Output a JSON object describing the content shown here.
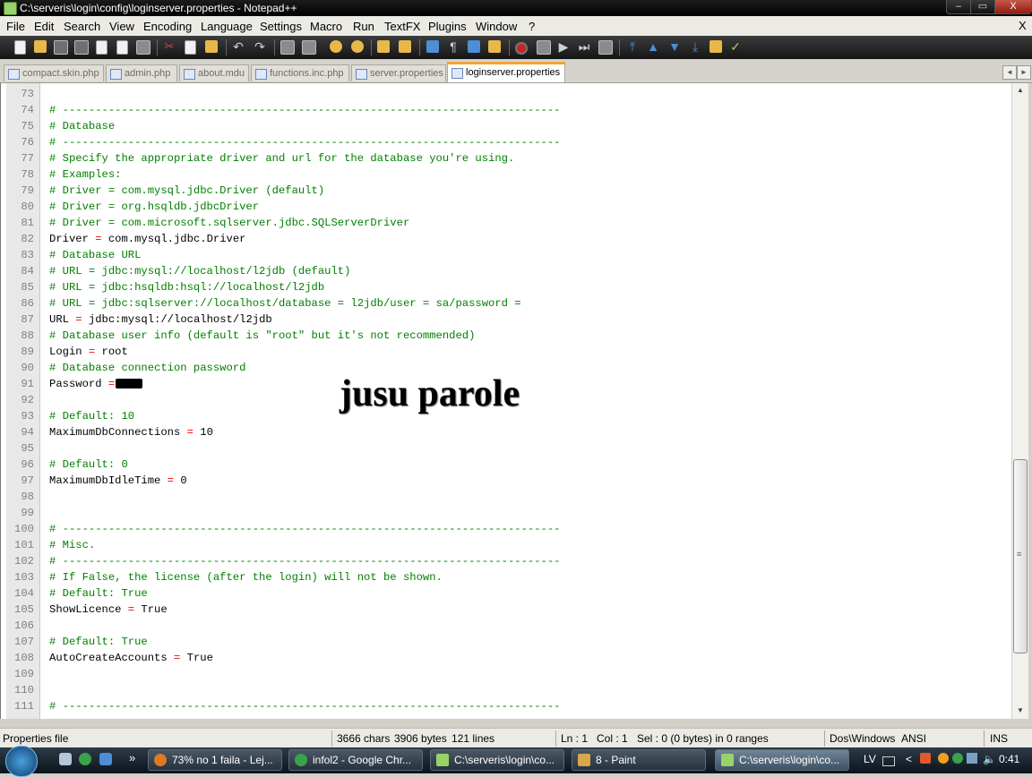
{
  "window": {
    "title": "C:\\serveris\\login\\config\\loginserver.properties - Notepad++",
    "min_glyph": "–",
    "max_glyph": "▭",
    "close_glyph": "X"
  },
  "menu": {
    "items": [
      "File",
      "Edit",
      "Search",
      "View",
      "Encoding",
      "Language",
      "Settings",
      "Macro",
      "Run",
      "TextFX",
      "Plugins",
      "Window",
      "?"
    ],
    "close_label": "X"
  },
  "tabs": [
    {
      "label": "compact.skin.php",
      "active": false
    },
    {
      "label": "admin.php",
      "active": false
    },
    {
      "label": "about.mdu",
      "active": false
    },
    {
      "label": "functions.inc.php",
      "active": false
    },
    {
      "label": "server.properties",
      "active": false
    },
    {
      "label": "loginserver.properties",
      "active": true
    }
  ],
  "tab_scroll": {
    "left": "◄",
    "right": "►"
  },
  "editor": {
    "lines": [
      {
        "n": "73",
        "type": "blank"
      },
      {
        "n": "74",
        "type": "comment",
        "text": "# ----------------------------------------------------------------------------"
      },
      {
        "n": "75",
        "type": "comment",
        "text": "# Database"
      },
      {
        "n": "76",
        "type": "comment",
        "text": "# ----------------------------------------------------------------------------"
      },
      {
        "n": "77",
        "type": "comment",
        "text": "# Specify the appropriate driver and url for the database you're using."
      },
      {
        "n": "78",
        "type": "comment",
        "text": "# Examples:"
      },
      {
        "n": "79",
        "type": "comment",
        "text": "# Driver = com.mysql.jdbc.Driver (default)"
      },
      {
        "n": "80",
        "type": "comment",
        "text": "# Driver = org.hsqldb.jdbcDriver"
      },
      {
        "n": "81",
        "type": "comment",
        "text": "# Driver = com.microsoft.sqlserver.jdbc.SQLServerDriver"
      },
      {
        "n": "82",
        "type": "kv",
        "key": "Driver",
        "value": "com.mysql.jdbc.Driver"
      },
      {
        "n": "83",
        "type": "comment",
        "text": "# Database URL"
      },
      {
        "n": "84",
        "type": "comment",
        "text": "# URL = jdbc:mysql://localhost/l2jdb (default)"
      },
      {
        "n": "85",
        "type": "comment",
        "text": "# URL = jdbc:hsqldb:hsql://localhost/l2jdb"
      },
      {
        "n": "86",
        "type": "comment",
        "text": "# URL = jdbc:sqlserver://localhost/database = l2jdb/user = sa/password ="
      },
      {
        "n": "87",
        "type": "kv",
        "key": "URL",
        "value": "jdbc:mysql://localhost/l2jdb"
      },
      {
        "n": "88",
        "type": "comment",
        "text": "# Database user info (default is \"root\" but it's not recommended)"
      },
      {
        "n": "89",
        "type": "kv",
        "key": "Login",
        "value": "root"
      },
      {
        "n": "90",
        "type": "comment",
        "text": "# Database connection password"
      },
      {
        "n": "91",
        "type": "kv-redacted",
        "key": "Password"
      },
      {
        "n": "92",
        "type": "blank"
      },
      {
        "n": "93",
        "type": "comment",
        "text": "# Default: 10"
      },
      {
        "n": "94",
        "type": "kv",
        "key": "MaximumDbConnections",
        "value": "10"
      },
      {
        "n": "95",
        "type": "blank"
      },
      {
        "n": "96",
        "type": "comment",
        "text": "# Default: 0"
      },
      {
        "n": "97",
        "type": "kv",
        "key": "MaximumDbIdleTime",
        "value": "0"
      },
      {
        "n": "98",
        "type": "blank"
      },
      {
        "n": "99",
        "type": "blank"
      },
      {
        "n": "100",
        "type": "comment",
        "text": "# ----------------------------------------------------------------------------"
      },
      {
        "n": "101",
        "type": "comment",
        "text": "# Misc."
      },
      {
        "n": "102",
        "type": "comment",
        "text": "# ----------------------------------------------------------------------------"
      },
      {
        "n": "103",
        "type": "comment",
        "text": "# If False, the license (after the login) will not be shown."
      },
      {
        "n": "104",
        "type": "comment",
        "text": "# Default: True"
      },
      {
        "n": "105",
        "type": "kv",
        "key": "ShowLicence",
        "value": "True"
      },
      {
        "n": "106",
        "type": "blank"
      },
      {
        "n": "107",
        "type": "comment",
        "text": "# Default: True"
      },
      {
        "n": "108",
        "type": "kv",
        "key": "AutoCreateAccounts",
        "value": "True"
      },
      {
        "n": "109",
        "type": "blank"
      },
      {
        "n": "110",
        "type": "blank"
      },
      {
        "n": "111",
        "type": "comment",
        "text": "# ----------------------------------------------------------------------------"
      }
    ],
    "overlay_text": "jusu parole"
  },
  "status": {
    "file_type": "Properties file",
    "chars": "3666 chars",
    "bytes": "3906 bytes",
    "lines": "121 lines",
    "ln": "Ln : 1",
    "col": "Col : 1",
    "sel": "Sel : 0 (0 bytes) in 0 ranges",
    "eol": "Dos\\Windows",
    "encoding": "ANSI",
    "mode": "INS"
  },
  "taskbar": {
    "quicklaunch_more": "»",
    "tasks": [
      {
        "label": "73% no 1 faila - Lej...",
        "color": "#e07a1f",
        "active": false
      },
      {
        "label": "infol2 - Google Chr...",
        "color": "#3aa34a",
        "active": false
      },
      {
        "label": "C:\\serveris\\login\\co...",
        "color": "#9ad26a",
        "active": false
      },
      {
        "label": "8 - Paint",
        "color": "#d8a74a",
        "active": false
      },
      {
        "label": "C:\\serveris\\login\\co...",
        "color": "#9ad26a",
        "active": true
      }
    ],
    "tray": {
      "lang": "LV",
      "chevron": "<",
      "clock": "0:41"
    }
  },
  "colors": {
    "comment": "#008000",
    "operator": "#ff0000",
    "active_tab_accent": "#f5a43a"
  }
}
